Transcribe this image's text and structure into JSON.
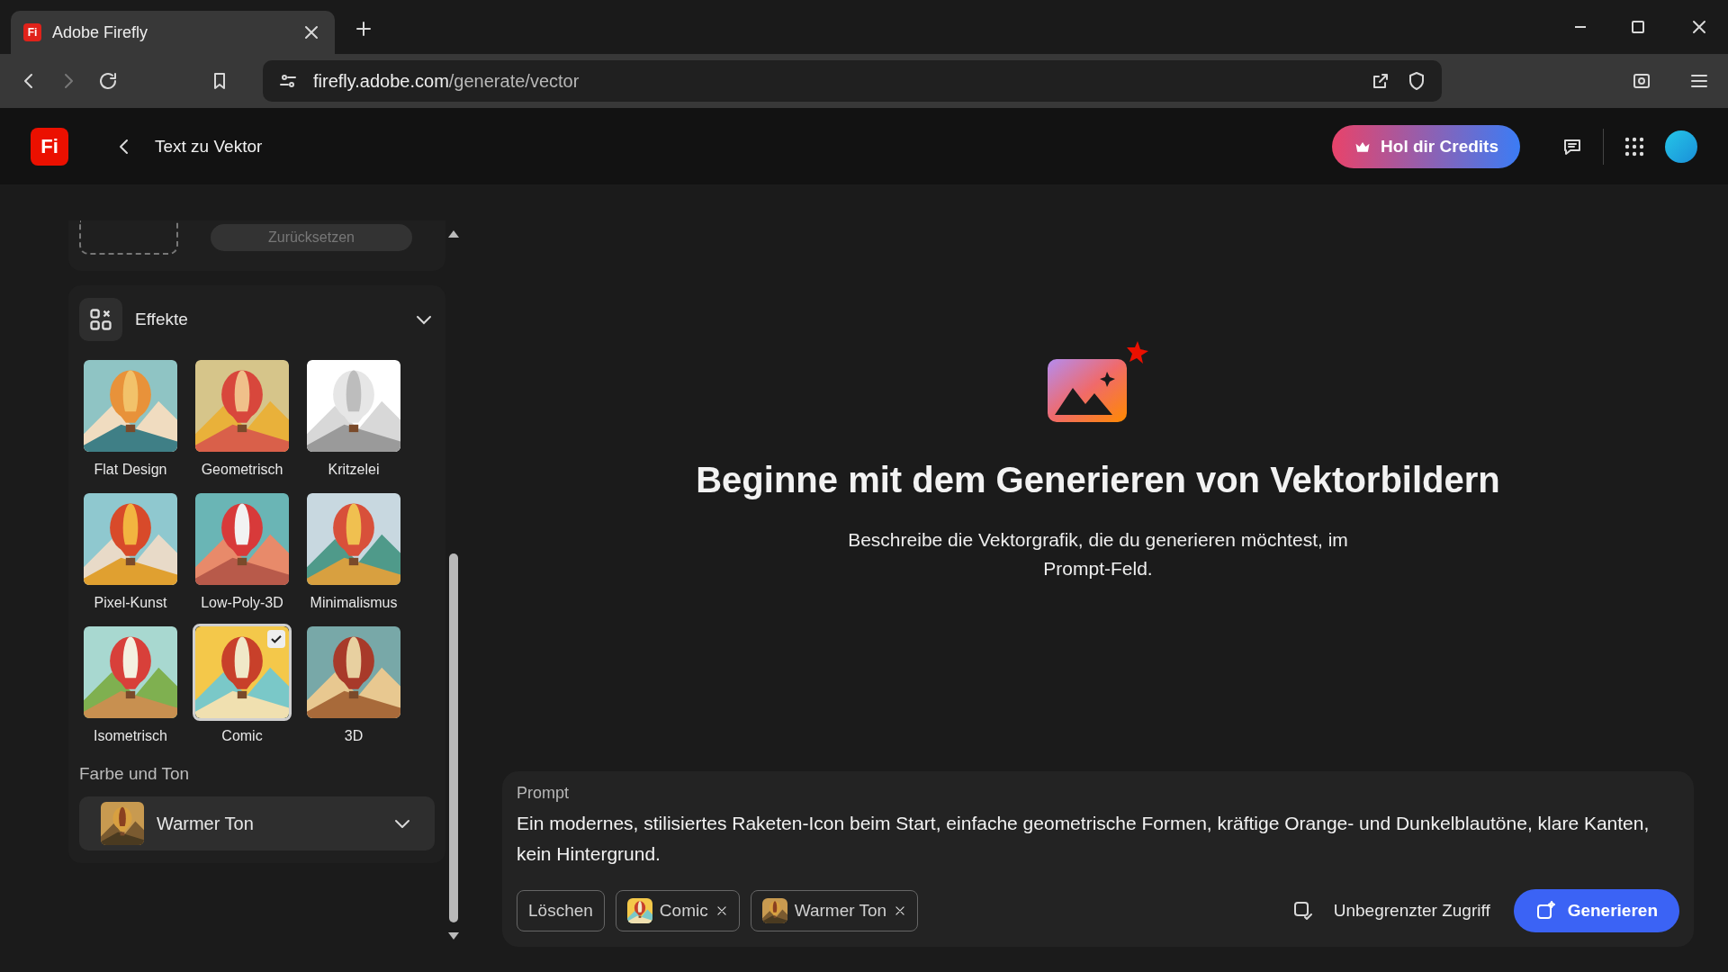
{
  "browser": {
    "favicon": "Fi",
    "tab_title": "Adobe Firefly",
    "url_host": "firefly.adobe.com",
    "url_path": "/generate/vector"
  },
  "header": {
    "logo": "Fi",
    "title": "Text zu Vektor",
    "credits_button": "Hol dir Credits"
  },
  "sidebar": {
    "reset_button": "Zurücksetzen",
    "effects": {
      "title": "Effekte",
      "expanded": true,
      "items": [
        {
          "label": "Flat Design",
          "selected": false
        },
        {
          "label": "Geometrisch",
          "selected": false
        },
        {
          "label": "Kritzelei",
          "selected": false
        },
        {
          "label": "Pixel-Kunst",
          "selected": false
        },
        {
          "label": "Low-Poly-3D",
          "selected": false
        },
        {
          "label": "Minimalismus",
          "selected": false
        },
        {
          "label": "Isometrisch",
          "selected": false
        },
        {
          "label": "Comic",
          "selected": true
        },
        {
          "label": "3D",
          "selected": false
        }
      ]
    },
    "color_tone": {
      "label": "Farbe und Ton",
      "value": "Warmer Ton"
    }
  },
  "main": {
    "heading": "Beginne mit dem Generieren von Vektorbildern",
    "description": "Beschreibe die Vektorgrafik, die du generieren möchtest, im Prompt-Feld."
  },
  "prompt": {
    "label": "Prompt",
    "value": "Ein modernes, stilisiertes Raketen-Icon beim Start, einfache geometrische Formen, kräftige Orange- und Dunkelblautöne, klare Kanten, kein Hintergrund.",
    "chips": [
      {
        "label": "Löschen",
        "kind": "button"
      },
      {
        "label": "Comic",
        "kind": "tag"
      },
      {
        "label": "Warmer Ton",
        "kind": "tag"
      }
    ],
    "access": "Unbegrenzter Zugriff",
    "generate_button": "Generieren"
  }
}
